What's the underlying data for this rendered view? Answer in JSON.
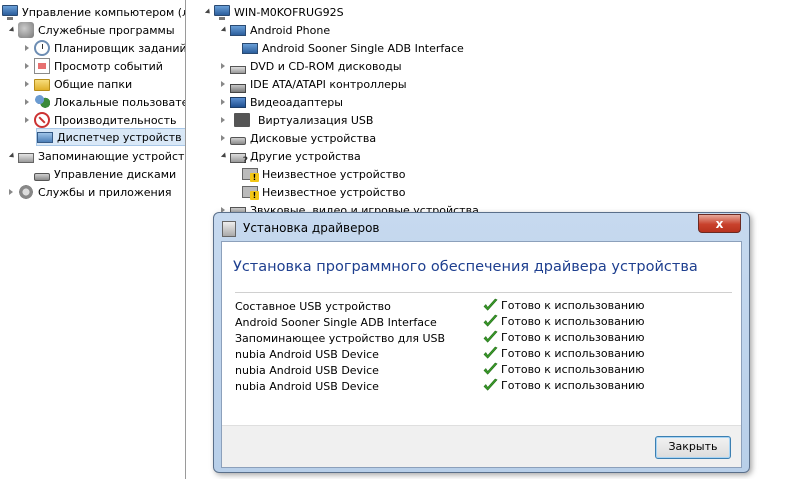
{
  "left_tree": {
    "items": [
      {
        "label": "Управление компьютером (л",
        "icon": "computer-icon"
      },
      {
        "label": "Служебные программы",
        "icon": "tools-icon"
      },
      {
        "label": "Планировщик заданий",
        "icon": "clock-icon"
      },
      {
        "label": "Просмотр событий",
        "icon": "event-log-icon"
      },
      {
        "label": "Общие папки",
        "icon": "folder-icon"
      },
      {
        "label": "Локальные пользовате",
        "icon": "users-icon"
      },
      {
        "label": "Производительность",
        "icon": "performance-icon"
      },
      {
        "label": "Диспетчер устройств",
        "icon": "device-manager-icon"
      },
      {
        "label": "Запоминающие устройст",
        "icon": "storage-icon"
      },
      {
        "label": "Управление дисками",
        "icon": "disk-icon"
      },
      {
        "label": "Службы и приложения",
        "icon": "services-icon"
      }
    ]
  },
  "device_tree": {
    "root": "WIN-M0KOFRUG92S",
    "items": [
      {
        "label": "Android Phone",
        "icon": "phone-icon"
      },
      {
        "label": "Android Sooner Single ADB Interface",
        "icon": "phone-device-icon"
      },
      {
        "label": "DVD и CD-ROM дисководы",
        "icon": "dvd-icon"
      },
      {
        "label": "IDE ATA/ATAPI контроллеры",
        "icon": "ide-icon"
      },
      {
        "label": "Видеоадаптеры",
        "icon": "video-icon"
      },
      {
        "label": "Виртуализация USB",
        "icon": "usb-icon"
      },
      {
        "label": "Дисковые устройства",
        "icon": "disk-drive-icon"
      },
      {
        "label": "Другие устройства",
        "icon": "other-devices-icon"
      },
      {
        "label": "Неизвестное устройство",
        "icon": "unknown-device-icon"
      },
      {
        "label": "Неизвестное устройство",
        "icon": "unknown-device-icon"
      },
      {
        "label": "Звуковые, видео и игровые устройства",
        "icon": "sound-icon"
      }
    ]
  },
  "dialog": {
    "title": "Установка драйверов",
    "close_glyph": "x",
    "heading": "Установка программного обеспечения драйвера устройства",
    "devices": [
      {
        "name": "Составное USB устройство",
        "status": "Готово к использованию"
      },
      {
        "name": "Android Sooner Single ADB Interface",
        "status": "Готово к использованию"
      },
      {
        "name": "Запоминающее устройство для USB",
        "status": "Готово к использованию"
      },
      {
        "name": "nubia Android USB Device",
        "status": "Готово к использованию"
      },
      {
        "name": "nubia Android USB Device",
        "status": "Готово к использованию"
      },
      {
        "name": "nubia Android USB Device",
        "status": "Готово к использованию"
      }
    ],
    "close_button": "Закрыть",
    "status_color": "#3a9a2a"
  }
}
